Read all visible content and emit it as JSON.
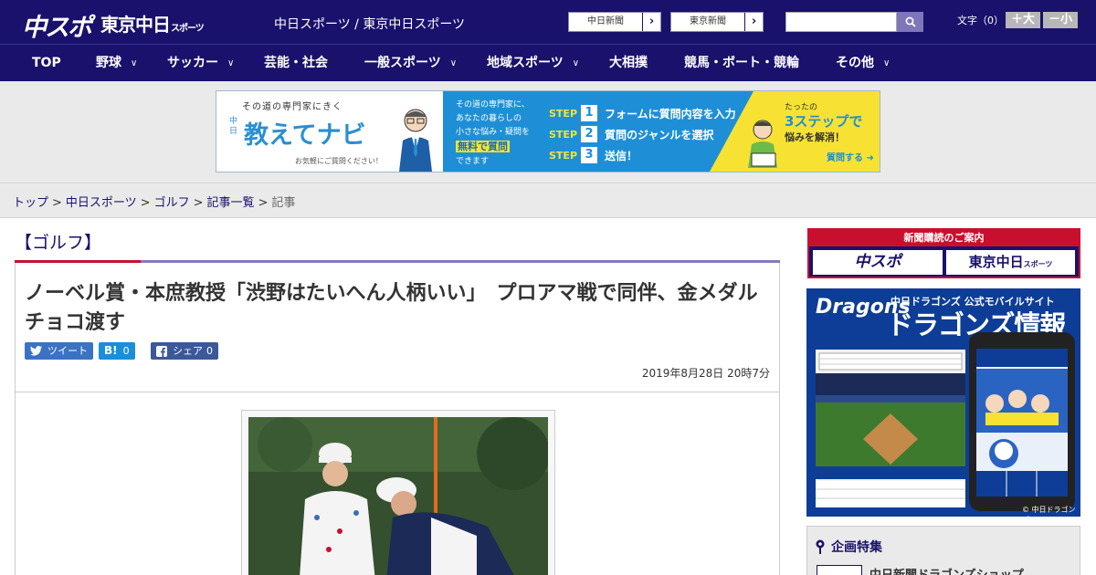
{
  "header": {
    "logo_main": "中スポ",
    "logo_sub": "東京中日",
    "logo_sub_small": "スポーツ",
    "site_name": "中日スポーツ / 東京中日スポーツ",
    "btn_chunichi": "中日新聞",
    "btn_tokyo": "東京新聞",
    "search_placeholder": "",
    "font_size_label": "文字（0）",
    "font_larger": "＋大",
    "font_smaller": "－小"
  },
  "nav": {
    "items": [
      "TOP",
      "野球",
      "サッカー",
      "芸能・社会",
      "一般スポーツ",
      "地域スポーツ",
      "大相撲",
      "競馬・ボート・競輪",
      "その他"
    ]
  },
  "ad": {
    "tagline": "その道の専門家にきく",
    "brand_small": "中日",
    "brand": "教えてナビ",
    "note": "お気軽にご質問ください！",
    "desc_1": "その道の専門家に、",
    "desc_2": "あなたの暮らしの",
    "desc_3": "小さな悩み・疑問を",
    "desc_highlight": "無料で質問",
    "desc_4": "できます",
    "step_label": "STEP",
    "steps": [
      {
        "num": "1",
        "text": "フォームに質問内容を入力"
      },
      {
        "num": "2",
        "text": "質問のジャンルを選択"
      },
      {
        "num": "3",
        "text": "送信！"
      }
    ],
    "y1": "たったの",
    "y2": "3ステップで",
    "y3": "悩みを解消！",
    "cta": "質問する ➜"
  },
  "breadcrumb": {
    "items": [
      "トップ",
      "中日スポーツ",
      "ゴルフ",
      "記事一覧"
    ],
    "current": "記事"
  },
  "article": {
    "category": "【ゴルフ】",
    "headline": "ノーベル賞・本庶教授「渋野はたいへん人柄いい」　プロアマ戦で同伴、金メダルチョコ渡す",
    "tweet_label": "ツイート",
    "hatena_icon": "B!",
    "hatena_count": "0",
    "fb_label": "シェア",
    "fb_count": "0",
    "date": "2019年8月28日 20時7分"
  },
  "sidebar": {
    "subscribe_title": "新聞購読のご案内",
    "subscribe_left": "中スポ",
    "subscribe_right": "東京中日",
    "subscribe_right_small": "スポーツ",
    "dragons_logo": "Dragons",
    "dragons_sub": "中日ドラゴンズ 公式モバイルサイト",
    "dragons_title": "ドラゴンズ情報",
    "dragons_copy": "© 中日ドラゴンズ",
    "feature_title": "企画特集",
    "feature_item": "中日新聞ドラゴンズショップ"
  },
  "colors": {
    "brand_navy": "#19116b",
    "accent_red": "#c8102e",
    "accent_purple": "#8379c0"
  }
}
